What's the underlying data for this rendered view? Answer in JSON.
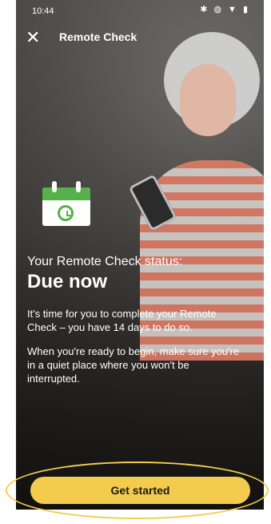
{
  "status_bar": {
    "time": "10:44",
    "icons": [
      "bluetooth-icon",
      "vibrate-icon",
      "wifi-icon",
      "battery-icon"
    ]
  },
  "header": {
    "title": "Remote Check"
  },
  "content": {
    "status_label": "Your Remote Check status:",
    "status_value": "Due now",
    "paragraph_1": "It's time for you to complete your Remote Check – you have 14 days to do so.",
    "paragraph_2": "When you're ready to begin, make sure you're in a quiet place where you won't be interrupted."
  },
  "actions": {
    "get_started_label": "Get started"
  },
  "colors": {
    "accent_yellow": "#f3cc4d",
    "calendar_green": "#56b14a"
  }
}
